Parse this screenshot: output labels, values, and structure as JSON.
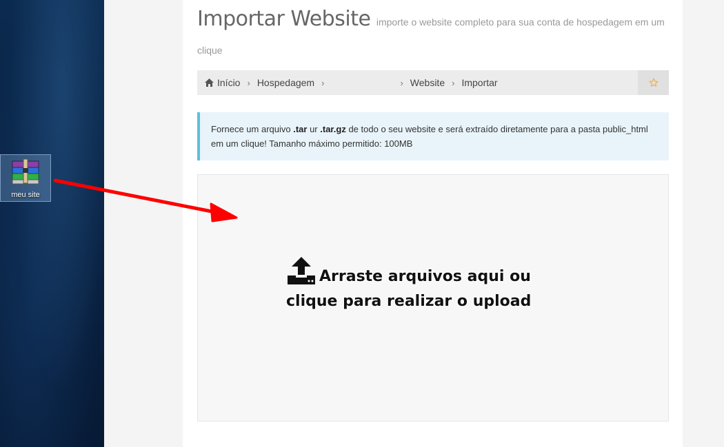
{
  "desktop": {
    "icon_label": "meu site"
  },
  "header": {
    "title": "Importar Website",
    "subtitle": "importe o website completo para sua conta de hospedagem em um clique"
  },
  "breadcrumb": {
    "home": "Início",
    "hosting": "Hospedagem",
    "website": "Website",
    "import": "Importar"
  },
  "alert": {
    "part1": "Fornece um arquivo ",
    "tar": ".tar",
    "part2": " ur ",
    "targz": ".tar.gz",
    "part3": " de todo o seu website e será extraído diretamente para a pasta public_html em um clique! Tamanho máximo permitido: 100MB"
  },
  "dropzone": {
    "message": "Arraste arquivos aqui ou clique para realizar o upload"
  },
  "colors": {
    "arrow": "#ff0000",
    "alert_border": "#5bc0de",
    "star": "#f0ad4e"
  },
  "icons": [
    "home-icon",
    "chevron-right-icon",
    "star-icon",
    "upload-icon",
    "rar-archive-icon"
  ]
}
